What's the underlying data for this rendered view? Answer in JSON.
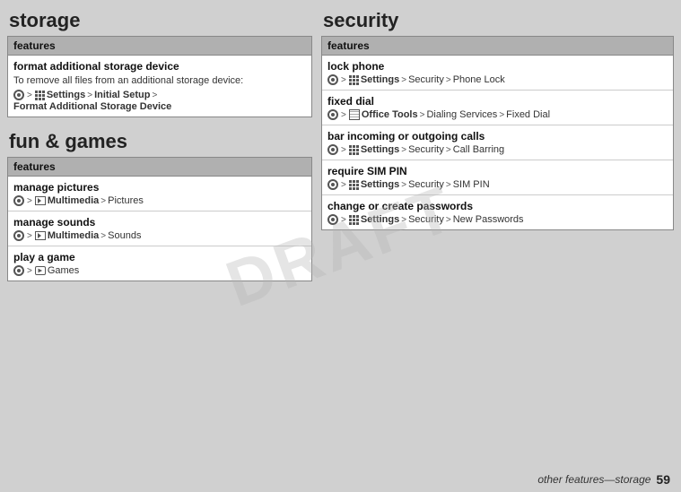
{
  "watermark": "DRAFT",
  "left": {
    "storage_title": "storage",
    "storage_table": {
      "header": "features",
      "rows": [
        {
          "title": "format additional storage device",
          "desc": "To remove all files from an additional storage device:",
          "path": [
            {
              "type": "bullet"
            },
            {
              "type": "arrow"
            },
            {
              "type": "settings-icon"
            },
            {
              "type": "text",
              "value": "Settings",
              "bold": true
            },
            {
              "type": "arrow"
            },
            {
              "type": "text",
              "value": "Initial Setup",
              "bold": true
            },
            {
              "type": "arrow"
            },
            {
              "type": "text",
              "value": "Format Additional Storage Device",
              "bold": true
            }
          ]
        }
      ]
    },
    "fun_title": "fun & games",
    "fun_table": {
      "header": "features",
      "rows": [
        {
          "title": "manage pictures",
          "path_simple": "• > Multimedia > Pictures"
        },
        {
          "title": "manage sounds",
          "path_simple": "• > Multimedia > Sounds"
        },
        {
          "title": "play a game",
          "path_simple": "• > Games"
        }
      ]
    }
  },
  "right": {
    "security_title": "security",
    "security_table": {
      "header": "features",
      "rows": [
        {
          "title": "lock phone",
          "path_label": "• > Settings > Security > Phone Lock"
        },
        {
          "title": "fixed dial",
          "path_label": "• > Office Tools > Dialing Services > Fixed Dial"
        },
        {
          "title": "bar incoming or outgoing calls",
          "path_label": "• > Settings > Security > Call Barring"
        },
        {
          "title": "require SIM PIN",
          "path_label": "• > Settings > Security > SIM PIN"
        },
        {
          "title": "change or create passwords",
          "path_label": "• > Settings > Security > New Passwords"
        }
      ]
    }
  },
  "footer": {
    "text": "other features—storage",
    "page": "59"
  }
}
